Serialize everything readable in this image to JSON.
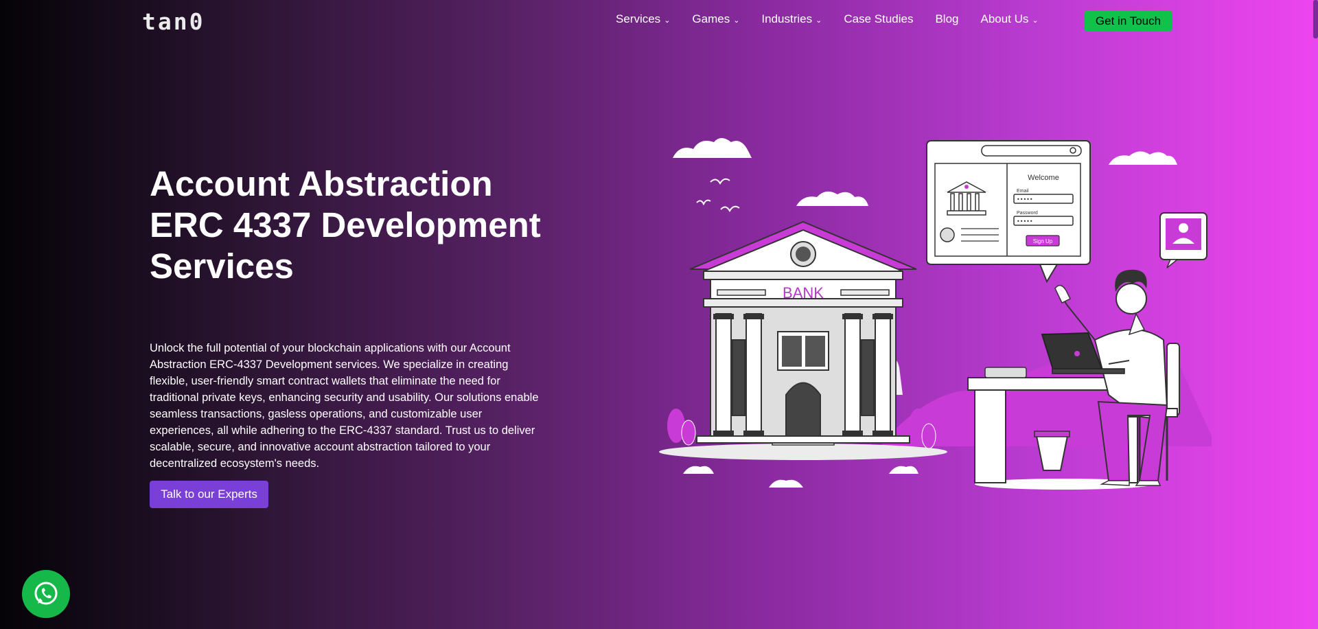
{
  "brand": {
    "logo_text": "tan0"
  },
  "nav": {
    "items": [
      {
        "label": "Services",
        "has_dropdown": true
      },
      {
        "label": "Games",
        "has_dropdown": true
      },
      {
        "label": "Industries",
        "has_dropdown": true
      },
      {
        "label": "Case Studies",
        "has_dropdown": false
      },
      {
        "label": "Blog",
        "has_dropdown": false
      },
      {
        "label": "About Us",
        "has_dropdown": true
      }
    ],
    "cta_label": "Get in Touch"
  },
  "hero": {
    "title_lines": [
      "Account Abstraction",
      "ERC 4337 Development",
      "Services"
    ],
    "description": "Unlock the full potential of your blockchain applications with our Account Abstraction ERC-4337 Development services. We specialize in creating flexible, user-friendly smart contract wallets that eliminate the need for traditional private keys, enhancing security and usability. Our solutions enable seamless transactions, gasless operations, and customizable user experiences, all while adhering to the ERC-4337 standard. Trust us to deliver scalable, secure, and innovative account abstraction tailored to your decentralized ecosystem's needs.",
    "cta_label": "Talk to our Experts"
  },
  "illustration": {
    "bank_sign": "BANK",
    "login_card": {
      "title": "Welcome",
      "email_label": "Email",
      "email_value": "•••••",
      "password_label": "Password",
      "password_value": "•••••",
      "button_label": "Sign Up"
    }
  },
  "colors": {
    "accent_green": "#10c24a",
    "accent_purple": "#7a3fd6",
    "illustration_magenta": "#c93bd6"
  },
  "icons": {
    "chevron": "chevron-down-icon",
    "whatsapp": "whatsapp-icon",
    "search": "search-icon"
  }
}
